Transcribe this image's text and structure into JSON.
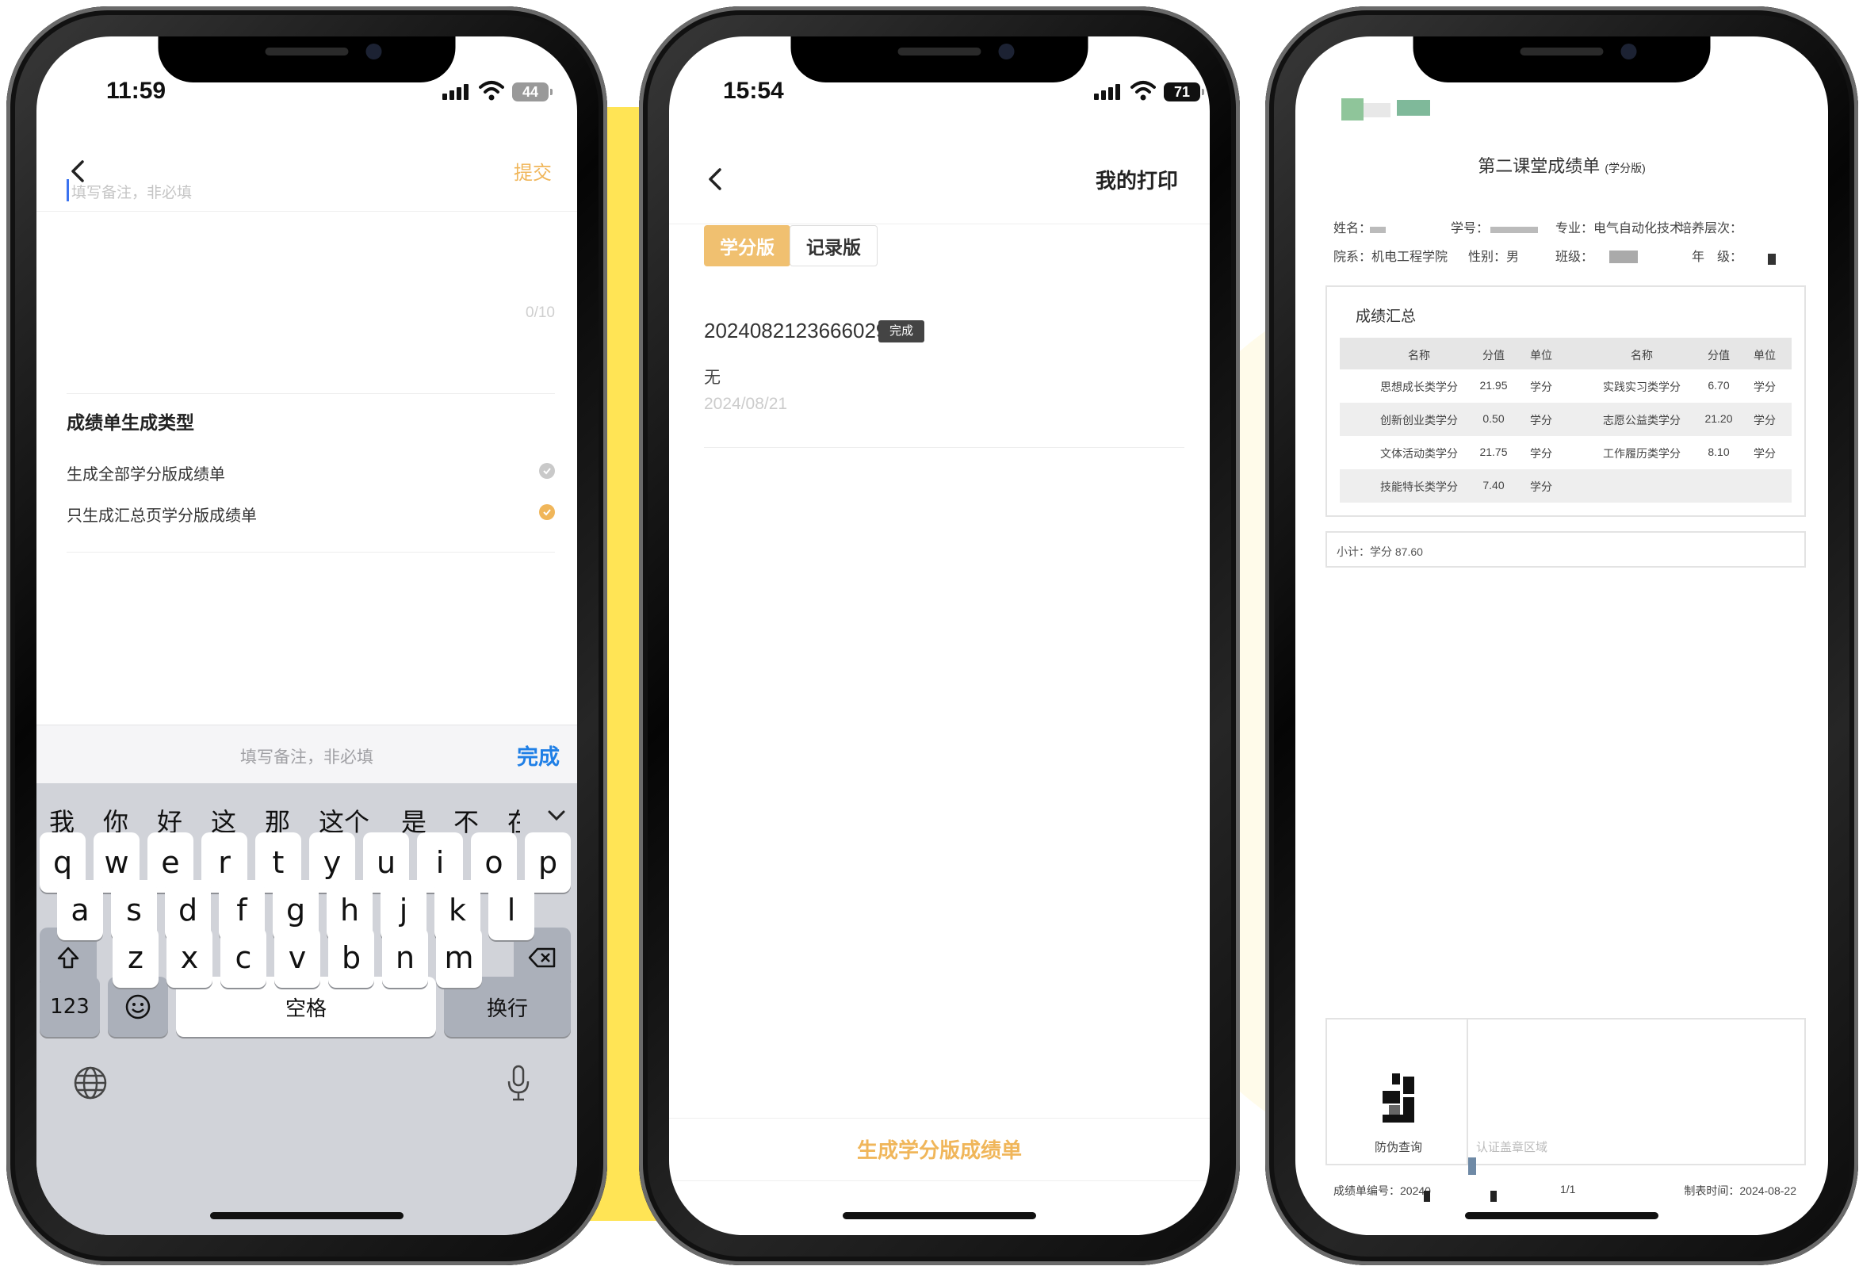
{
  "phone1": {
    "time": "11:59",
    "battery": "44",
    "nav": {
      "submit_label": "提交"
    },
    "note": {
      "placeholder": "填写备注，非必填",
      "counter": "0/10"
    },
    "section_title": "成绩单生成类型",
    "options": [
      {
        "label": "生成全部学分版成绩单",
        "selected": false
      },
      {
        "label": "只生成汇总页学分版成绩单",
        "selected": true
      }
    ],
    "accessory": {
      "placeholder": "填写备注，非必填",
      "done_label": "完成"
    },
    "keyboard": {
      "candidates": [
        "我",
        "你",
        "好",
        "这",
        "那",
        "这个",
        "是",
        "不",
        "在"
      ],
      "row1": [
        "q",
        "w",
        "e",
        "r",
        "t",
        "y",
        "u",
        "i",
        "o",
        "p"
      ],
      "row2": [
        "a",
        "s",
        "d",
        "f",
        "g",
        "h",
        "j",
        "k",
        "l"
      ],
      "row3": [
        "z",
        "x",
        "c",
        "v",
        "b",
        "n",
        "m"
      ],
      "numbers_label": "123",
      "space_label": "空格",
      "return_label": "换行"
    },
    "icons": [
      "back-icon",
      "check-icon",
      "chevron-down-icon",
      "shift-icon",
      "delete-icon",
      "emoji-icon",
      "globe-icon",
      "microphone-icon"
    ]
  },
  "phone2": {
    "time": "15:54",
    "battery": "71",
    "nav": {
      "title": "我的打印"
    },
    "tabs": [
      {
        "label": "学分版",
        "active": true
      },
      {
        "label": "记录版",
        "active": false
      }
    ],
    "record": {
      "id": "2024082123666029",
      "status": "完成",
      "note": "无",
      "date": "2024/08/21"
    },
    "generate_button": "生成学分版成绩单"
  },
  "phone3": {
    "doc_title": "第二课堂成绩单",
    "doc_title_suffix": "(学分版)",
    "info": {
      "name_label": "姓名：",
      "student_no_label": "学号：",
      "major_label": "专业：",
      "major_value": "电气自动化技术",
      "level_label": "培养层次：",
      "dept_label": "院系：",
      "dept_value": "机电工程学院",
      "gender_label": "性别：",
      "gender_value": "男",
      "class_label": "班级：",
      "grade_label": "年　级："
    },
    "summary": {
      "title": "成绩汇总",
      "headers": [
        "名称",
        "分值",
        "单位",
        "名称",
        "分值",
        "单位"
      ],
      "rows": [
        [
          "思想成长类学分",
          "21.95",
          "学分",
          "实践实习类学分",
          "6.70",
          "学分"
        ],
        [
          "创新创业类学分",
          "0.50",
          "学分",
          "志愿公益类学分",
          "21.20",
          "学分"
        ],
        [
          "文体活动类学分",
          "21.75",
          "学分",
          "工作履历类学分",
          "8.10",
          "学分"
        ],
        [
          "技能特长类学分",
          "7.40",
          "学分",
          "",
          "",
          ""
        ]
      ],
      "subtotal": "小计：学分 87.60"
    },
    "footer": {
      "anti_fake_label": "防伪查询",
      "seal_area_label": "认证盖章区域",
      "serial_label": "成绩单编号：20240",
      "page_label": "1/1",
      "made_time": "制表时间：2024-08-22"
    }
  },
  "colors": {
    "accent_orange": "#f0b65a",
    "tab_active": "#f0c070",
    "ios_blue": "#1f7fe6",
    "yellow_deco": "#ffe455"
  }
}
